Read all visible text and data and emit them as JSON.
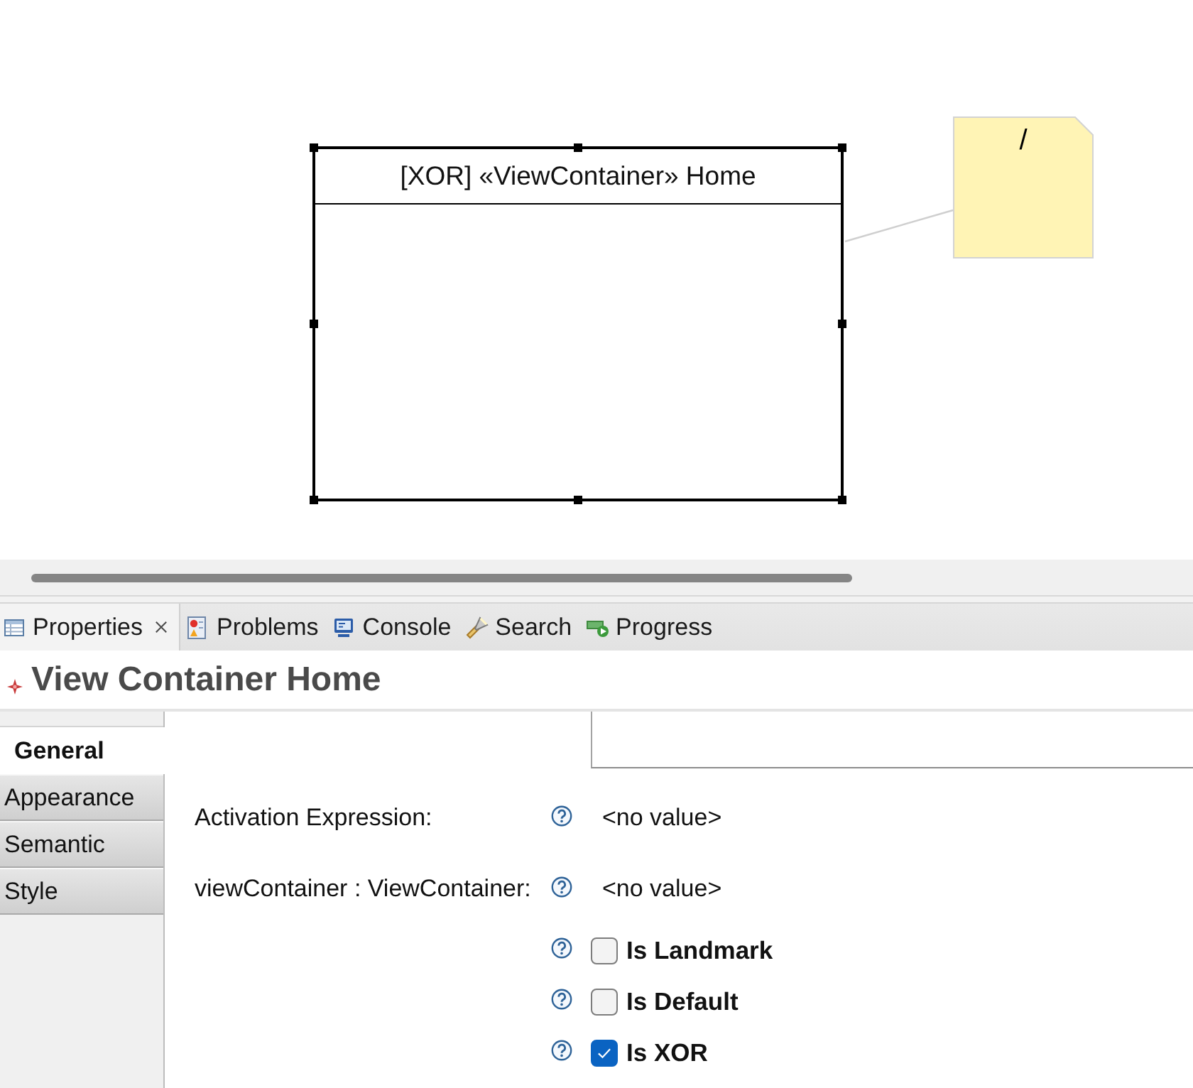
{
  "diagram": {
    "container": {
      "title": "[XOR] «ViewContainer» Home",
      "selected": true
    },
    "note": {
      "text": "/"
    }
  },
  "view_tabs": [
    {
      "label": "Properties",
      "selected": true,
      "closable": true
    },
    {
      "label": "Problems",
      "selected": false,
      "closable": false
    },
    {
      "label": "Console",
      "selected": false,
      "closable": false
    },
    {
      "label": "Search",
      "selected": false,
      "closable": false
    },
    {
      "label": "Progress",
      "selected": false,
      "closable": false
    }
  ],
  "properties": {
    "title": "View Container Home",
    "sections": [
      {
        "label": "General",
        "selected": true
      },
      {
        "label": "Appearance",
        "selected": false
      },
      {
        "label": "Semantic",
        "selected": false
      },
      {
        "label": "Style",
        "selected": false
      }
    ],
    "fields": [
      {
        "kind": "text",
        "label": "Activation Expression:",
        "value": "<no value>"
      },
      {
        "kind": "text",
        "label": "viewContainer : ViewContainer:",
        "value": "<no value>"
      },
      {
        "kind": "checkbox",
        "label": "Is Landmark",
        "checked": false
      },
      {
        "kind": "checkbox",
        "label": "Is Default",
        "checked": false
      },
      {
        "kind": "checkbox",
        "label": "Is XOR",
        "checked": true
      }
    ]
  }
}
